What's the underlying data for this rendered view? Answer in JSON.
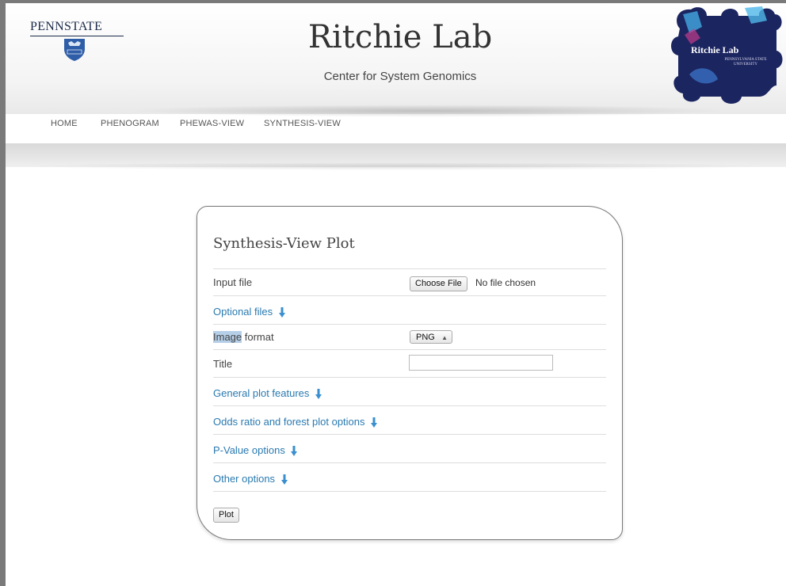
{
  "header": {
    "university": "PENNSTATE",
    "shield_year": "1855",
    "lab_title": "Ritchie Lab",
    "lab_subtitle": "Center for System Genomics",
    "logo_text": "Ritchie Lab",
    "logo_subtext": "PENNSYLVANIA STATE UNIVERSITY"
  },
  "nav": {
    "items": [
      {
        "label": "HOME"
      },
      {
        "label": "PHENOGRAM"
      },
      {
        "label": "PHEWAS-VIEW"
      },
      {
        "label": "SYNTHESIS-VIEW"
      }
    ]
  },
  "form": {
    "title": "Synthesis-View Plot",
    "input_file": {
      "label": "Input file",
      "button_label": "Choose File",
      "status": "No file chosen"
    },
    "optional_files": {
      "label": "Optional files"
    },
    "image_format": {
      "label_highlight": "Image",
      "label_rest": " format",
      "selected": "PNG"
    },
    "title_field": {
      "label": "Title",
      "value": ""
    },
    "general_plot_features": {
      "label": "General plot features"
    },
    "odds_ratio_options": {
      "label": "Odds ratio and forest plot options"
    },
    "pvalue_options": {
      "label": "P-Value options"
    },
    "other_options": {
      "label": "Other options"
    },
    "plot_button": "Plot"
  },
  "colors": {
    "link": "#2a7ab0",
    "arrow": "#3a8fd0",
    "highlight": "#b6cfe8"
  }
}
